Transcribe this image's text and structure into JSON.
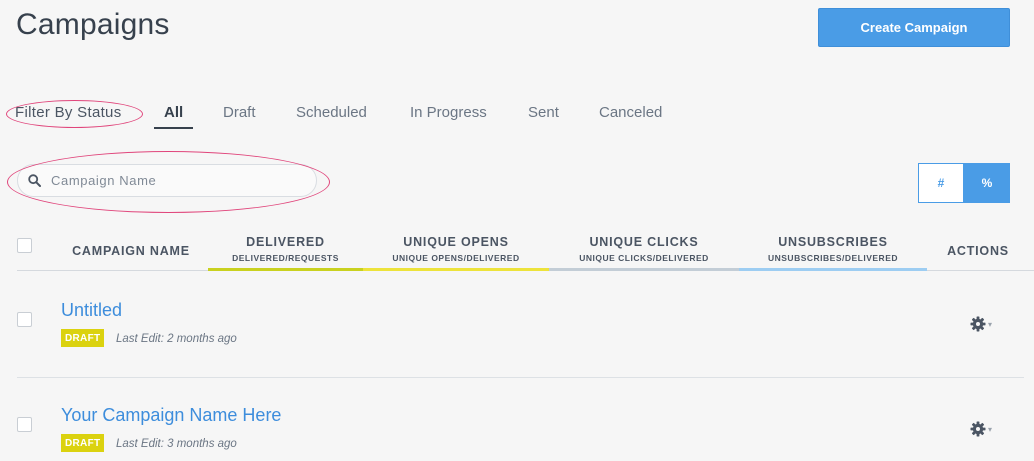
{
  "header": {
    "title": "Campaigns",
    "create_label": "Create Campaign"
  },
  "filter": {
    "label": "Filter By Status",
    "tabs": [
      {
        "label": "All",
        "active": true
      },
      {
        "label": "Draft",
        "active": false
      },
      {
        "label": "Scheduled",
        "active": false
      },
      {
        "label": "In Progress",
        "active": false
      },
      {
        "label": "Sent",
        "active": false
      },
      {
        "label": "Canceled",
        "active": false
      }
    ]
  },
  "search": {
    "placeholder": "Campaign Name",
    "value": ""
  },
  "toggle": {
    "count_label": "#",
    "percent_label": "%",
    "selected": "%"
  },
  "table": {
    "columns": [
      {
        "title": "CAMPAIGN NAME",
        "sub": ""
      },
      {
        "title": "DELIVERED",
        "sub": "DELIVERED/REQUESTS"
      },
      {
        "title": "UNIQUE OPENS",
        "sub": "UNIQUE OPENS/DELIVERED"
      },
      {
        "title": "UNIQUE CLICKS",
        "sub": "UNIQUE CLICKS/DELIVERED"
      },
      {
        "title": "UNSUBSCRIBES",
        "sub": "UNSUBSCRIBES/DELIVERED"
      },
      {
        "title": "ACTIONS",
        "sub": ""
      }
    ],
    "column_colors": [
      "#c9d11f",
      "#ede33b",
      "#c3cdd6",
      "#9dcdf2"
    ],
    "rows": [
      {
        "name": "Untitled",
        "status": "DRAFT",
        "last_edit": "Last Edit: 2 months ago"
      },
      {
        "name": "Your Campaign Name Here",
        "status": "DRAFT",
        "last_edit": "Last Edit: 3 months ago"
      }
    ]
  },
  "colors": {
    "accent": "#4a9ce6",
    "link": "#3d8ddc",
    "draft_badge": "#dbd20f",
    "annotation": "#e0457b"
  },
  "icons": {
    "search": "search-icon",
    "gear": "gear-icon",
    "caret": "chevron-down-icon"
  }
}
